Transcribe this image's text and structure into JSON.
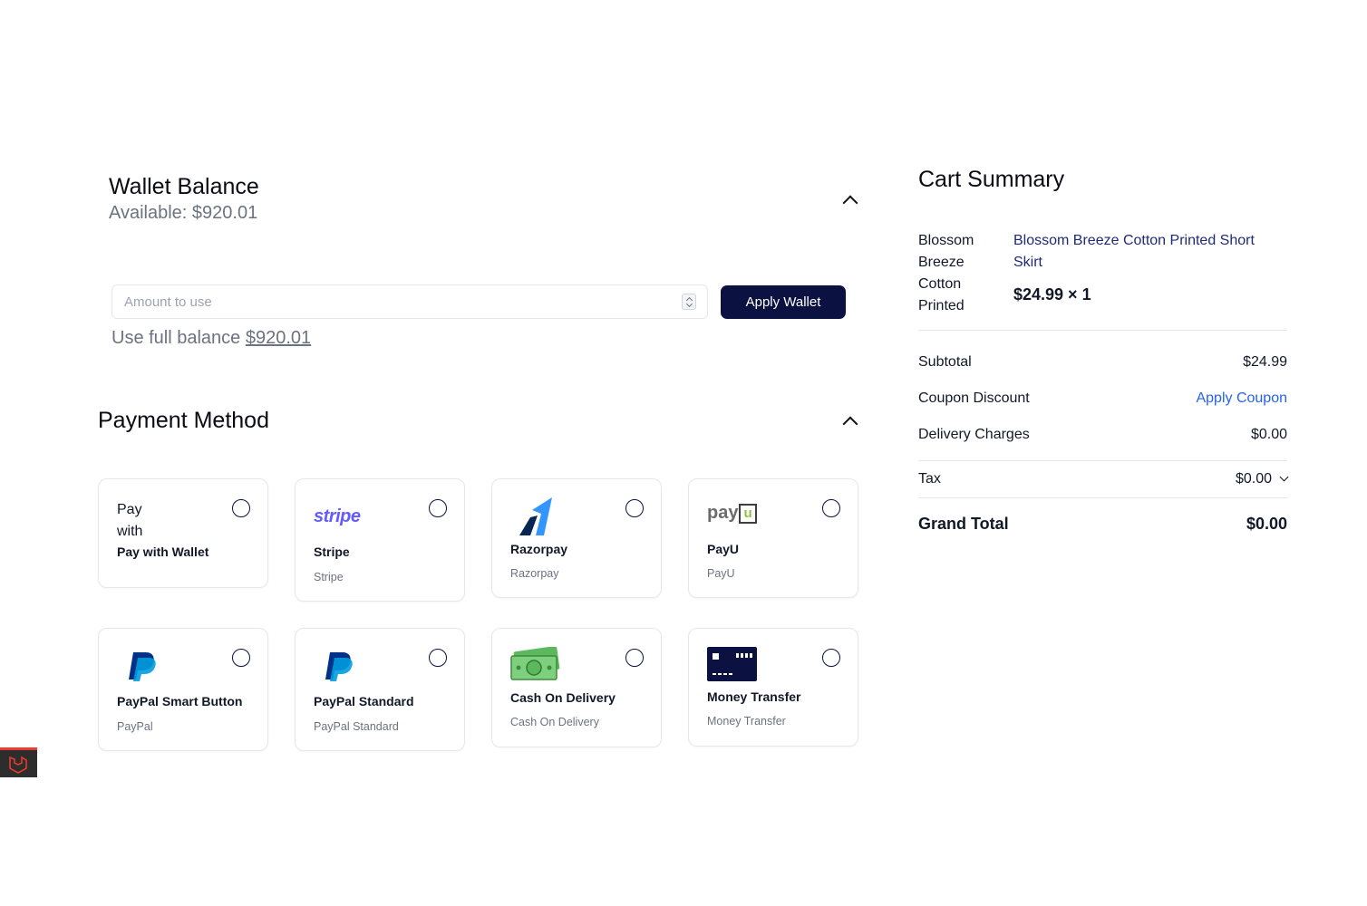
{
  "wallet": {
    "title": "Wallet Balance",
    "available": "Available: $920.01",
    "amount_placeholder": "Amount to use",
    "apply_label": "Apply Wallet",
    "full_balance_text": "Use full balance ",
    "full_balance_amount": "$920.01"
  },
  "payment": {
    "title": "Payment Method",
    "methods": [
      {
        "top": "Pay with",
        "name": "Pay with Wallet",
        "sub": ""
      },
      {
        "logo": "stripe",
        "name": "Stripe",
        "sub": "Stripe"
      },
      {
        "logo": "razorpay-icon",
        "name": "Razorpay",
        "sub": "Razorpay"
      },
      {
        "logo": "payu",
        "logo_text": "pay",
        "logo_u": "u",
        "name": "PayU",
        "sub": "PayU"
      },
      {
        "logo": "paypal-icon",
        "name": "PayPal Smart Button",
        "sub": "PayPal"
      },
      {
        "logo": "paypal-icon",
        "name": "PayPal Standard",
        "sub": "PayPal Standard"
      },
      {
        "logo": "cash-icon",
        "name": "Cash On Delivery",
        "sub": "Cash On Delivery"
      },
      {
        "logo": "card-icon",
        "name": "Money Transfer",
        "sub": "Money Transfer"
      }
    ]
  },
  "cart": {
    "title": "Cart Summary",
    "product_image_alt": "Blossom Breeze Cotton Printed",
    "product_name": "Blossom Breeze Cotton Printed Short Skirt",
    "product_price": "$24.99 × 1",
    "subtotal_label": "Subtotal",
    "subtotal_value": "$24.99",
    "coupon_label": "Coupon Discount",
    "coupon_action": "Apply Coupon",
    "delivery_label": "Delivery Charges",
    "delivery_value": "$0.00",
    "tax_label": "Tax",
    "tax_value": "$0.00",
    "grand_label": "Grand Total",
    "grand_value": "$0.00"
  },
  "colors": {
    "primary_button": "#0b1140",
    "link_blue": "#2563eb",
    "product_link": "#1e2a78",
    "stripe": "#635bff"
  }
}
